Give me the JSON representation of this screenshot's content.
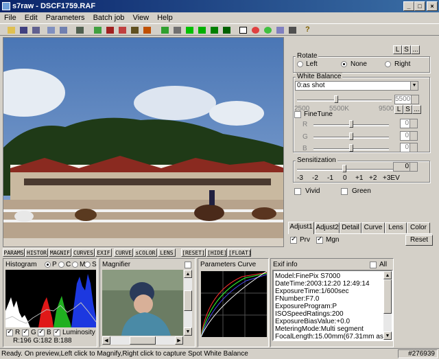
{
  "window": {
    "title": "s7raw - DSCF1759.RAF"
  },
  "menu": [
    "File",
    "Edit",
    "Parameters",
    "Batch job",
    "View",
    "Help"
  ],
  "rotate": {
    "label": "Rotate",
    "options": [
      "Left",
      "None",
      "Right"
    ],
    "selected": "None",
    "btn_l": "L",
    "btn_s": "S",
    "btn_more": "..."
  },
  "white_balance": {
    "label": "White Balance",
    "preset": "0:as shot",
    "value": "5500",
    "ticks": [
      "2500",
      "5500K",
      "9500"
    ],
    "finetune_label": "FineTune",
    "channels": [
      "R",
      "G",
      "B"
    ],
    "channel_values": [
      "0",
      "0",
      "0"
    ],
    "btn_l": "L",
    "btn_s": "S",
    "btn_more": "..."
  },
  "sensitization": {
    "label": "Sensitization",
    "value": "0",
    "ticks": [
      "-3",
      "-2",
      "-1",
      "0",
      "+1",
      "+2",
      "+3EV"
    ]
  },
  "checks": {
    "vivid": "Vivid",
    "green": "Green",
    "prv": "Prv",
    "mgn": "Mgn"
  },
  "tabs": [
    "Adjust1",
    "Adjust2",
    "Detail",
    "Curve",
    "Lens",
    "Color"
  ],
  "active_tab": "Adjust1",
  "reset_label": "Reset",
  "panel_tabs": [
    "PARAMS",
    "HISTOR",
    "MAGNIF",
    "CURVES",
    "EXIF",
    "CURVE",
    "sCOLOR",
    "LENS",
    "[RESET]",
    "[HIDE]",
    "[FLOAT]"
  ],
  "histogram": {
    "title": "Histogram",
    "modes": [
      "P",
      "C",
      "M",
      "S"
    ],
    "selected_mode": "P",
    "channels": [
      "R",
      "G",
      "B",
      "Luminosity"
    ],
    "readout": "R:196 G:182 B:188"
  },
  "magnifier": {
    "title": "Magnifier"
  },
  "curve": {
    "title": "Parameters Curve"
  },
  "exif": {
    "title": "Exif info",
    "all_label": "All",
    "lines": [
      "Model:FinePix S7000",
      "DateTime:2003:12:20 12:49:14",
      "ExposureTime:1/600sec",
      "FNumber:F7.0",
      "ExposureProgram:P",
      "ISOSpeedRatings:200",
      "ExposureBiasValue:+0.0",
      "MeteringMode:Multi segment",
      "FocalLength:15.00mm(67.31mm as 135)"
    ]
  },
  "status": {
    "text": "Ready.  On preview,Left click to Magnify,Right click to capture Spot White Balance",
    "color_code": "#276939"
  },
  "colors": {
    "title_start": "#0a246a",
    "title_end": "#3a6ea5",
    "face": "#d4d0c8"
  }
}
